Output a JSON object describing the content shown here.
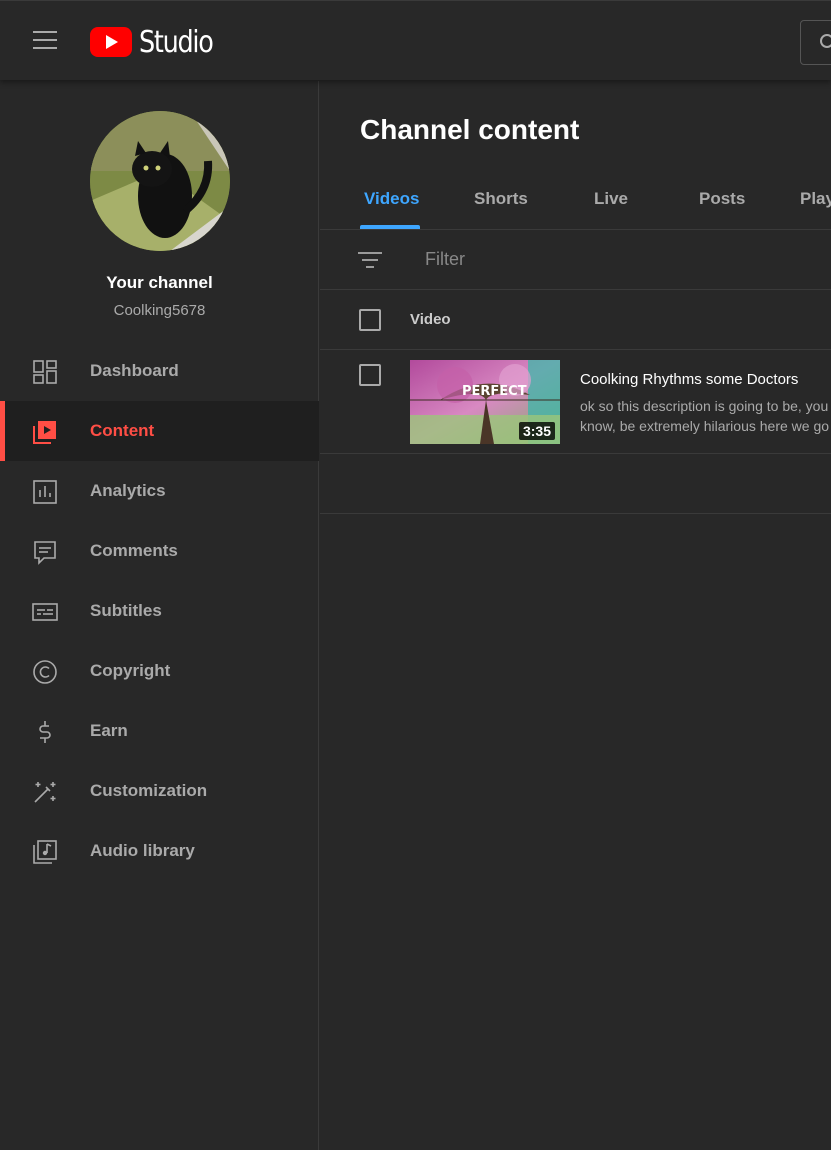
{
  "app": {
    "logo_text": "Studio"
  },
  "channel": {
    "title": "Your channel",
    "handle": "Coolking5678"
  },
  "sidebar": {
    "items": [
      {
        "label": "Dashboard",
        "icon": "dashboard-icon"
      },
      {
        "label": "Content",
        "icon": "content-icon",
        "active": true
      },
      {
        "label": "Analytics",
        "icon": "analytics-icon"
      },
      {
        "label": "Comments",
        "icon": "comments-icon"
      },
      {
        "label": "Subtitles",
        "icon": "subtitles-icon"
      },
      {
        "label": "Copyright",
        "icon": "copyright-icon"
      },
      {
        "label": "Earn",
        "icon": "earn-icon"
      },
      {
        "label": "Customization",
        "icon": "customization-icon"
      },
      {
        "label": "Audio library",
        "icon": "audio-library-icon"
      }
    ]
  },
  "main": {
    "title": "Channel content",
    "tabs": [
      {
        "label": "Videos",
        "active": true
      },
      {
        "label": "Shorts"
      },
      {
        "label": "Live"
      },
      {
        "label": "Posts"
      },
      {
        "label": "Playlists"
      }
    ],
    "filter_placeholder": "Filter",
    "table": {
      "column_video": "Video",
      "rows": [
        {
          "title": "Coolking Rhythms some Doctors",
          "description": "ok so this description is going to be, you know, be extremely hilarious here we go LIKE",
          "duration": "3:35",
          "thumbnail_text": "PERFECT"
        }
      ]
    }
  },
  "colors": {
    "accent_active": "#ff4e45",
    "tab_active": "#3ea6ff",
    "background": "#282828"
  }
}
